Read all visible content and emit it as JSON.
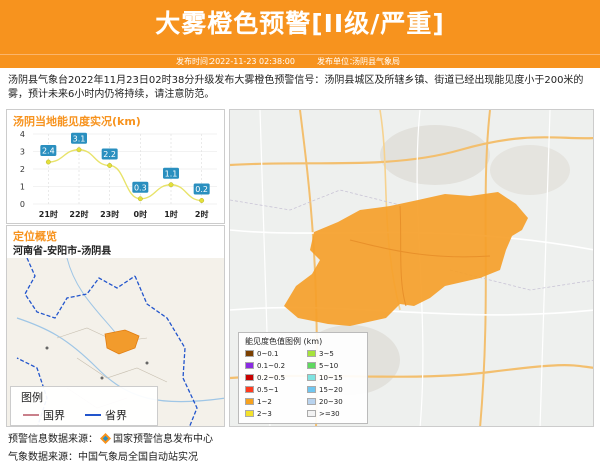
{
  "header": {
    "title": "大雾橙色预警[II级/严重]",
    "publish_time_label": "发布时间：",
    "publish_time": "2022-11-23 02:38:00",
    "publish_unit_label": "发布单位：",
    "publish_unit": "汤阴县气象局"
  },
  "description": "汤阴县气象台2022年11月23日02时38分升级发布大雾橙色预警信号：汤阴县城区及所辖乡镇、街道已经出现能见度小于200米的雾，预计未来6小时内仍将持续，请注意防范。",
  "visibility_panel": {
    "title": "汤阴当地能见度实况(km)"
  },
  "chart_data": {
    "type": "line",
    "title": "汤阴当地能见度实况(km)",
    "categories": [
      "21时",
      "22时",
      "23时",
      "0时",
      "1时",
      "2时"
    ],
    "values": [
      2.4,
      3.1,
      2.2,
      0.3,
      1.1,
      0.2
    ],
    "ylim": [
      0,
      4
    ],
    "yticks": [
      "0",
      "1",
      "2",
      "3",
      "4"
    ],
    "grid": true,
    "xlabel": "",
    "ylabel": ""
  },
  "location_panel": {
    "title": "定位概览",
    "subtitle": "河南省-安阳市-汤阴县",
    "legend_title": "图例",
    "legend_items": [
      {
        "label": "国界",
        "color": "#c9808a"
      },
      {
        "label": "省界",
        "color": "#2255cc"
      }
    ]
  },
  "map_legend": {
    "title": "能见度色值图例 (km)",
    "items": [
      {
        "label": "0~0.1",
        "color": "#7b3f00"
      },
      {
        "label": "0.1~0.2",
        "color": "#8a2be2"
      },
      {
        "label": "0.2~0.5",
        "color": "#c80000"
      },
      {
        "label": "0.5~1",
        "color": "#ff3b1f"
      },
      {
        "label": "1~2",
        "color": "#f7a21e"
      },
      {
        "label": "2~3",
        "color": "#f3e12b"
      },
      {
        "label": "3~5",
        "color": "#a6e33a"
      },
      {
        "label": "5~10",
        "color": "#5fd85f"
      },
      {
        "label": "10~15",
        "color": "#7fe3e0"
      },
      {
        "label": "15~20",
        "color": "#6fc6f0"
      },
      {
        "label": "20~30",
        "color": "#b9d3ee"
      },
      {
        "label": ">=30",
        "color": "#f2f2f2"
      }
    ]
  },
  "footer": {
    "source_label": "预警信息数据来源：",
    "source_name": "国家预警信息发布中心",
    "weather_label": "气象数据来源：",
    "weather_name": "中国气象局全国自动站实况"
  },
  "colors": {
    "accent": "#f7931e",
    "fog_area": "#f5a02a",
    "point": "#e4e03a",
    "label_box": "#2a8fbf"
  }
}
